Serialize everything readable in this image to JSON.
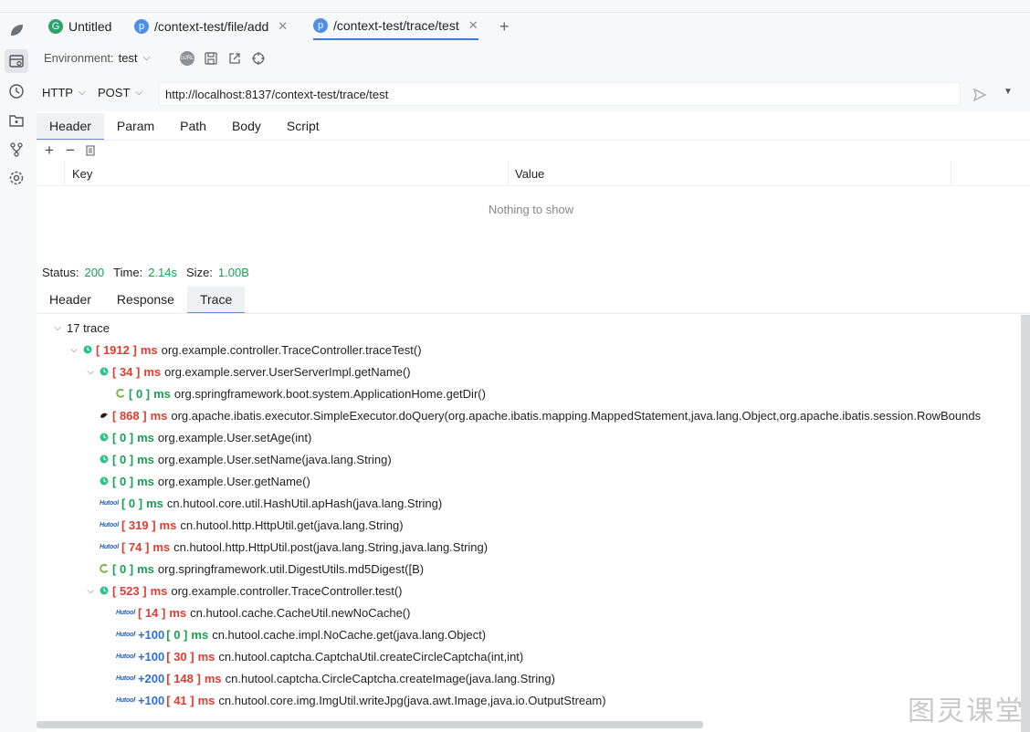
{
  "tabs": [
    {
      "badge": "G",
      "label": "Untitled",
      "badge_color": "#2aa36b"
    },
    {
      "badge": "p",
      "label": "/context-test/file/add",
      "badge_color": "#4c8ee8"
    },
    {
      "badge": "p",
      "label": "/context-test/trace/test",
      "badge_color": "#4c8ee8"
    }
  ],
  "env": {
    "label": "Environment:",
    "value": "test"
  },
  "request": {
    "protocol": "HTTP",
    "method": "POST",
    "url": "http://localhost:8137/context-test/trace/test"
  },
  "request_tabs": [
    "Header",
    "Param",
    "Path",
    "Body",
    "Script"
  ],
  "kv": {
    "key_header": "Key",
    "value_header": "Value",
    "empty": "Nothing to show"
  },
  "status": {
    "status_label": "Status:",
    "status_value": "200",
    "time_label": "Time:",
    "time_value": "2.14s",
    "size_label": "Size:",
    "size_value": "1.00B"
  },
  "response_tabs": [
    "Header",
    "Response",
    "Trace"
  ],
  "trace": {
    "root": "17 trace",
    "rows": [
      {
        "indent": 1,
        "chev": "v",
        "icon": "clock",
        "ms": "1912",
        "color": "red",
        "text": "org.example.controller.TraceController.traceTest()"
      },
      {
        "indent": 2,
        "chev": "v",
        "icon": "clock",
        "ms": "34",
        "color": "red",
        "text": "org.example.server.UserServerImpl.getName()"
      },
      {
        "indent": 3,
        "chev": "",
        "icon": "spring",
        "ms": "0",
        "color": "green",
        "text": "org.springframework.boot.system.ApplicationHome.getDir()"
      },
      {
        "indent": 2,
        "chev": "",
        "icon": "bird",
        "ms": "868",
        "color": "red",
        "text": "org.apache.ibatis.executor.SimpleExecutor.doQuery(org.apache.ibatis.mapping.MappedStatement,java.lang.Object,org.apache.ibatis.session.RowBounds"
      },
      {
        "indent": 2,
        "chev": "",
        "icon": "clock",
        "ms": "0",
        "color": "green",
        "text": "org.example.User.setAge(int)"
      },
      {
        "indent": 2,
        "chev": "",
        "icon": "clock",
        "ms": "0",
        "color": "green",
        "text": "org.example.User.setName(java.lang.String)"
      },
      {
        "indent": 2,
        "chev": "",
        "icon": "clock",
        "ms": "0",
        "color": "green",
        "text": "org.example.User.getName()"
      },
      {
        "indent": 2,
        "chev": "",
        "icon": "hutool",
        "ms": "0",
        "color": "green",
        "text": "cn.hutool.core.util.HashUtil.apHash(java.lang.String)"
      },
      {
        "indent": 2,
        "chev": "",
        "icon": "hutool",
        "ms": "319",
        "color": "red",
        "text": "cn.hutool.http.HttpUtil.get(java.lang.String)"
      },
      {
        "indent": 2,
        "chev": "",
        "icon": "hutool",
        "ms": "74",
        "color": "red",
        "text": "cn.hutool.http.HttpUtil.post(java.lang.String,java.lang.String)"
      },
      {
        "indent": 2,
        "chev": "",
        "icon": "spring",
        "ms": "0",
        "color": "green",
        "text": "org.springframework.util.DigestUtils.md5Digest([B)"
      },
      {
        "indent": 2,
        "chev": "v",
        "icon": "clock",
        "ms": "523",
        "color": "red",
        "text": "org.example.controller.TraceController.test()"
      },
      {
        "indent": 3,
        "chev": "",
        "icon": "hutool",
        "ms": "14",
        "color": "red",
        "text": "cn.hutool.cache.CacheUtil.newNoCache()"
      },
      {
        "indent": 3,
        "chev": "",
        "icon": "hutool",
        "plus": "+100",
        "ms": "0",
        "color": "green",
        "text": "cn.hutool.cache.impl.NoCache.get(java.lang.Object)"
      },
      {
        "indent": 3,
        "chev": "",
        "icon": "hutool",
        "plus": "+100",
        "ms": "30",
        "color": "red",
        "text": "cn.hutool.captcha.CaptchaUtil.createCircleCaptcha(int,int)"
      },
      {
        "indent": 3,
        "chev": "",
        "icon": "hutool",
        "plus": "+200",
        "ms": "148",
        "color": "red",
        "text": "cn.hutool.captcha.CircleCaptcha.createImage(java.lang.String)"
      },
      {
        "indent": 3,
        "chev": "",
        "icon": "hutool",
        "plus": "+100",
        "ms": "41",
        "color": "red",
        "text": "cn.hutool.core.img.ImgUtil.writeJpg(java.awt.Image,java.io.OutputStream)"
      }
    ],
    "ms_unit": "ms",
    "hutool_text": "Hutool"
  },
  "watermark": "图灵课堂",
  "colors": {
    "accent": "#3a7bd5",
    "red": "#e03c31",
    "green": "#1aa051"
  }
}
